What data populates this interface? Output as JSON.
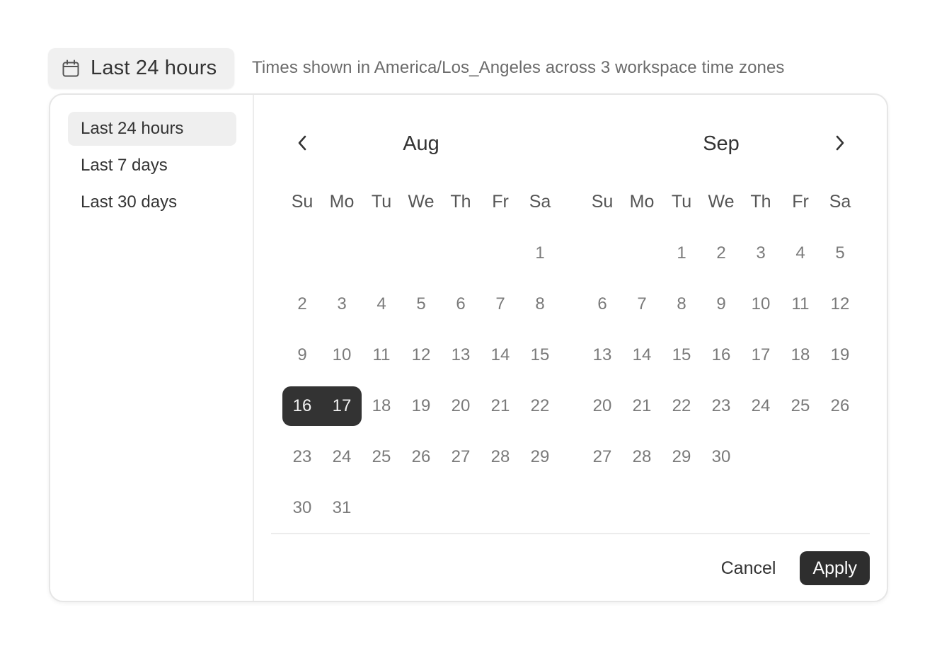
{
  "trigger": {
    "label": "Last 24 hours",
    "icon": "calendar-icon"
  },
  "timezone_note": "Times shown in America/Los_Angeles across 3 workspace time zones",
  "presets": [
    {
      "label": "Last 24 hours",
      "active": true
    },
    {
      "label": "Last 7 days",
      "active": false
    },
    {
      "label": "Last 30 days",
      "active": false
    }
  ],
  "nav": {
    "prev_icon": "chevron-left-icon",
    "next_icon": "chevron-right-icon"
  },
  "weekdays": [
    "Su",
    "Mo",
    "Tu",
    "We",
    "Th",
    "Fr",
    "Sa"
  ],
  "months": [
    {
      "title": "Aug",
      "weeks": [
        [
          "",
          "",
          "",
          "",
          "",
          "",
          "1"
        ],
        [
          "2",
          "3",
          "4",
          "5",
          "6",
          "7",
          "8"
        ],
        [
          "9",
          "10",
          "11",
          "12",
          "13",
          "14",
          "15"
        ],
        [
          "16",
          "17",
          "18",
          "19",
          "20",
          "21",
          "22"
        ],
        [
          "23",
          "24",
          "25",
          "26",
          "27",
          "28",
          "29"
        ],
        [
          "30",
          "31",
          "",
          "",
          "",
          "",
          ""
        ]
      ],
      "selected": [
        "16",
        "17"
      ]
    },
    {
      "title": "Sep",
      "weeks": [
        [
          "",
          "",
          "1",
          "2",
          "3",
          "4",
          "5"
        ],
        [
          "6",
          "7",
          "8",
          "9",
          "10",
          "11",
          "12"
        ],
        [
          "13",
          "14",
          "15",
          "16",
          "17",
          "18",
          "19"
        ],
        [
          "20",
          "21",
          "22",
          "23",
          "24",
          "25",
          "26"
        ],
        [
          "27",
          "28",
          "29",
          "30",
          "",
          "",
          ""
        ]
      ],
      "selected": []
    }
  ],
  "footer": {
    "cancel_label": "Cancel",
    "apply_label": "Apply"
  },
  "colors": {
    "selected_bg": "#333333",
    "apply_bg": "#2e2e2e",
    "preset_active_bg": "#efefef"
  }
}
